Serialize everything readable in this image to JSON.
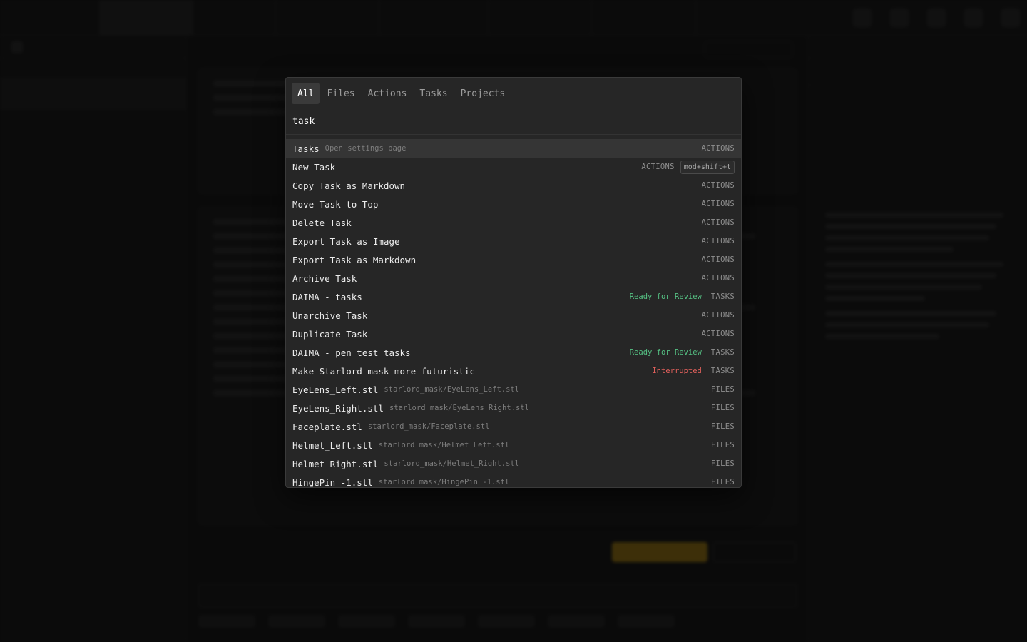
{
  "palette": {
    "tabs": [
      {
        "label": "All"
      },
      {
        "label": "Files"
      },
      {
        "label": "Actions"
      },
      {
        "label": "Tasks"
      },
      {
        "label": "Projects"
      }
    ],
    "active_tab": "All",
    "search_value": "task",
    "results": [
      {
        "name": "Tasks",
        "desc": "Open settings page",
        "badge": "",
        "category": "ACTIONS",
        "shortcut": ""
      },
      {
        "name": "New Task",
        "desc": "",
        "badge": "",
        "category": "ACTIONS",
        "shortcut": "mod+shift+t"
      },
      {
        "name": "Copy Task as Markdown",
        "desc": "",
        "badge": "",
        "category": "ACTIONS",
        "shortcut": ""
      },
      {
        "name": "Move Task to Top",
        "desc": "",
        "badge": "",
        "category": "ACTIONS",
        "shortcut": ""
      },
      {
        "name": "Delete Task",
        "desc": "",
        "badge": "",
        "category": "ACTIONS",
        "shortcut": ""
      },
      {
        "name": "Export Task as Image",
        "desc": "",
        "badge": "",
        "category": "ACTIONS",
        "shortcut": ""
      },
      {
        "name": "Export Task as Markdown",
        "desc": "",
        "badge": "",
        "category": "ACTIONS",
        "shortcut": ""
      },
      {
        "name": "Archive Task",
        "desc": "",
        "badge": "",
        "category": "ACTIONS",
        "shortcut": ""
      },
      {
        "name": "DAIMA - tasks",
        "desc": "",
        "badge": "Ready for Review",
        "category": "TASKS",
        "shortcut": ""
      },
      {
        "name": "Unarchive Task",
        "desc": "",
        "badge": "",
        "category": "ACTIONS",
        "shortcut": ""
      },
      {
        "name": "Duplicate Task",
        "desc": "",
        "badge": "",
        "category": "ACTIONS",
        "shortcut": ""
      },
      {
        "name": "DAIMA - pen test tasks",
        "desc": "",
        "badge": "Ready for Review",
        "category": "TASKS",
        "shortcut": ""
      },
      {
        "name": "Make Starlord mask more futuristic",
        "desc": "",
        "badge": "Interrupted",
        "category": "TASKS",
        "shortcut": ""
      },
      {
        "name": "EyeLens_Left.stl",
        "desc": "starlord_mask/EyeLens_Left.stl",
        "badge": "",
        "category": "FILES",
        "shortcut": ""
      },
      {
        "name": "EyeLens_Right.stl",
        "desc": "starlord_mask/EyeLens_Right.stl",
        "badge": "",
        "category": "FILES",
        "shortcut": ""
      },
      {
        "name": "Faceplate.stl",
        "desc": "starlord_mask/Faceplate.stl",
        "badge": "",
        "category": "FILES",
        "shortcut": ""
      },
      {
        "name": "Helmet_Left.stl",
        "desc": "starlord_mask/Helmet_Left.stl",
        "badge": "",
        "category": "FILES",
        "shortcut": ""
      },
      {
        "name": "Helmet_Right.stl",
        "desc": "starlord_mask/Helmet_Right.stl",
        "badge": "",
        "category": "FILES",
        "shortcut": ""
      },
      {
        "name": "HingePin_-1.stl",
        "desc": "starlord_mask/HingePin_-1.stl",
        "badge": "",
        "category": "FILES",
        "shortcut": ""
      }
    ]
  },
  "colors": {
    "ready": "#55c083",
    "interrupted": "#e0605b",
    "highlight_row": "#353535",
    "palette_bg": "#262626"
  }
}
